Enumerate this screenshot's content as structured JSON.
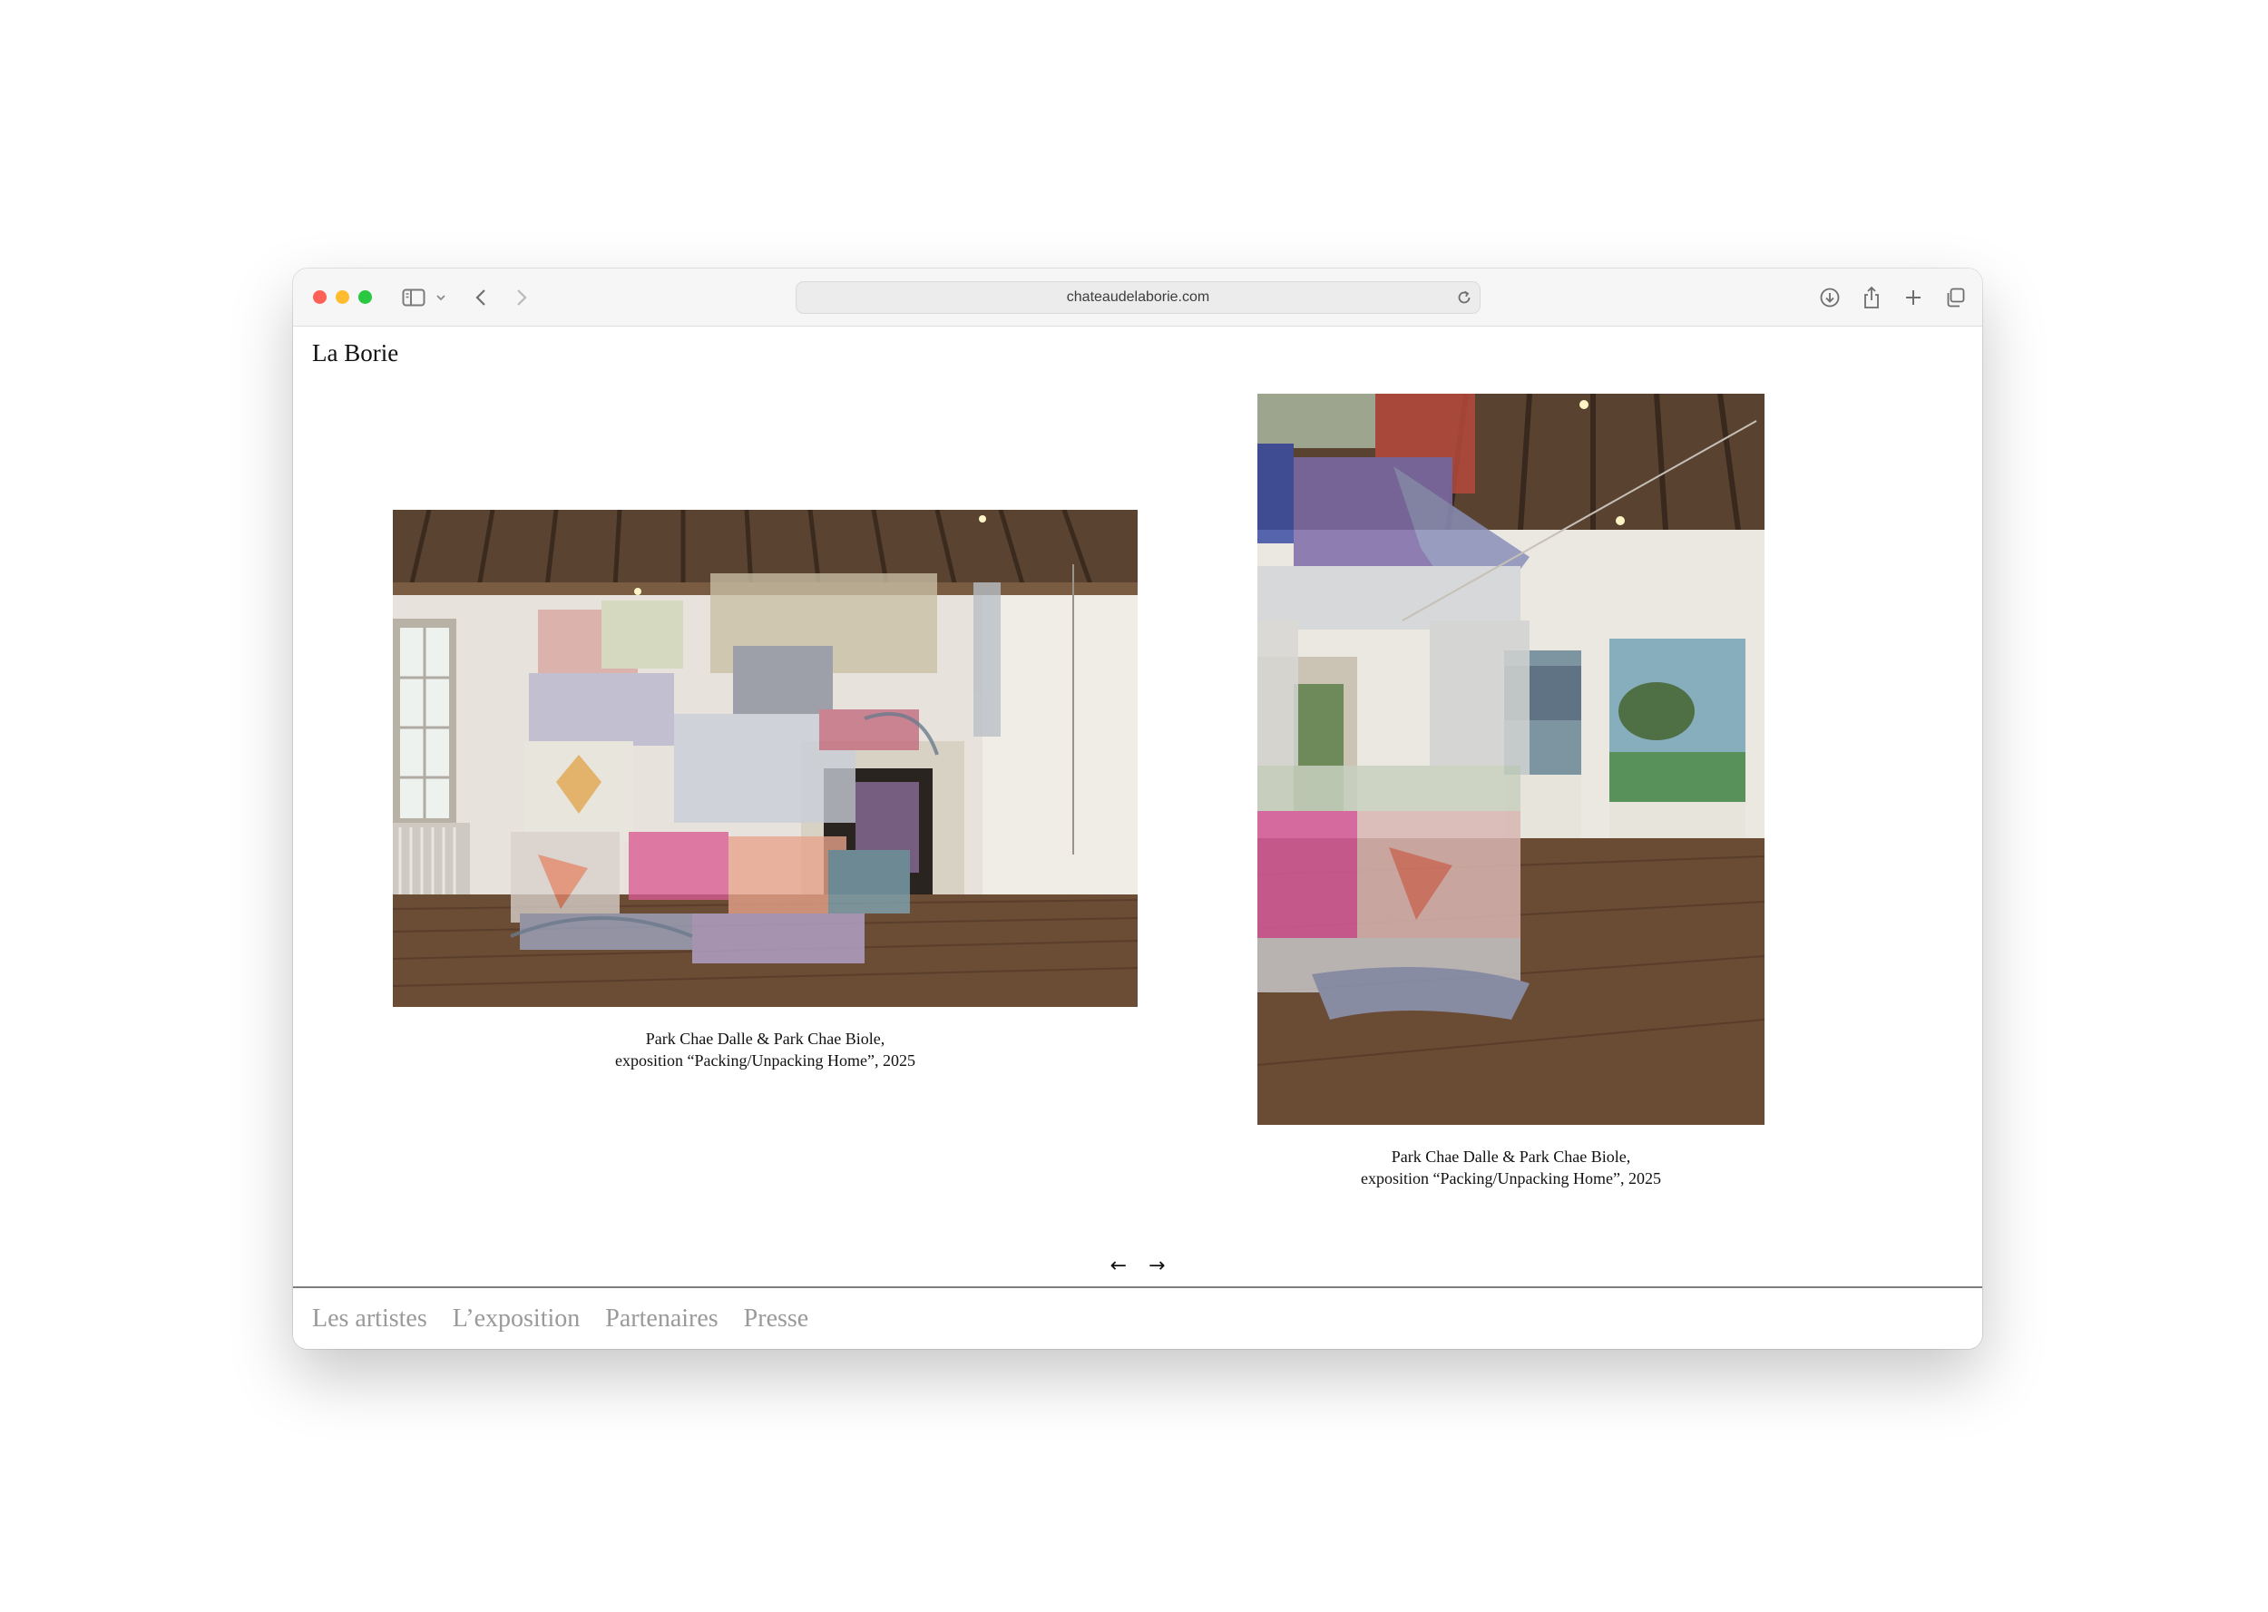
{
  "browser": {
    "url": "chateaudelaborie.com"
  },
  "site": {
    "title": "La Borie"
  },
  "gallery": {
    "items": [
      {
        "caption_line1": "Park Chae Dalle & Park Chae Biole,",
        "caption_line2": "exposition “Packing/Unpacking Home”, 2025"
      },
      {
        "caption_line1": "Park Chae Dalle & Park Chae Biole,",
        "caption_line2": "exposition “Packing/Unpacking Home”, 2025"
      }
    ],
    "prev_label": "←",
    "next_label": "→"
  },
  "footer_nav": {
    "items": [
      {
        "label": "Les artistes"
      },
      {
        "label": "L’exposition"
      },
      {
        "label": "Partenaires"
      },
      {
        "label": "Presse"
      }
    ]
  },
  "icons": {
    "sidebar": "sidebar-icon",
    "chevron": "chevron-down-icon",
    "back": "back-icon",
    "forward": "forward-icon",
    "reload": "reload-icon",
    "download": "download-icon",
    "share": "share-icon",
    "new_tab": "plus-icon",
    "tabs": "tab-overview-icon"
  },
  "colors": {
    "traffic_close": "#fe5f57",
    "traffic_minimize": "#febc2e",
    "traffic_maximize": "#28c840",
    "nav_link": "#9a9a9a"
  }
}
